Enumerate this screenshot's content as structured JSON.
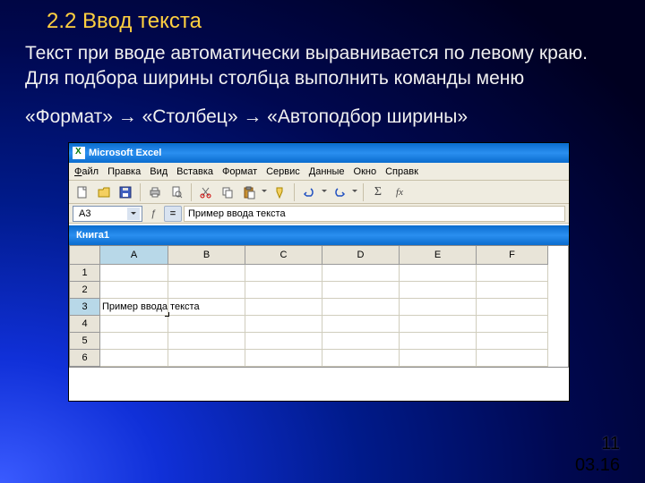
{
  "slide": {
    "title": "2.2 Ввод текста",
    "para1": "Текст при вводе автоматически выравнивается по левому краю. Для подбора ширины столбца выполнить команды меню",
    "para2": "«Формат» → «Столбец» → «Автоподбор ширины»",
    "page_num": "11",
    "date": "03.16"
  },
  "excel": {
    "app_title": "Microsoft Excel",
    "book_title": "Книга1",
    "menu": {
      "file": "Файл",
      "edit": "Правка",
      "view": "Вид",
      "insert": "Вставка",
      "format": "Формат",
      "tools": "Сервис",
      "data": "Данные",
      "window": "Окно",
      "help": "Справк"
    },
    "namebox": "A3",
    "formula": "Пример ввода текста",
    "fx_label": "fx",
    "columns": [
      "A",
      "B",
      "C",
      "D",
      "E",
      "F"
    ],
    "rows": [
      "1",
      "2",
      "3",
      "4",
      "5",
      "6"
    ],
    "cell_a3": "Пример ввода текста"
  }
}
